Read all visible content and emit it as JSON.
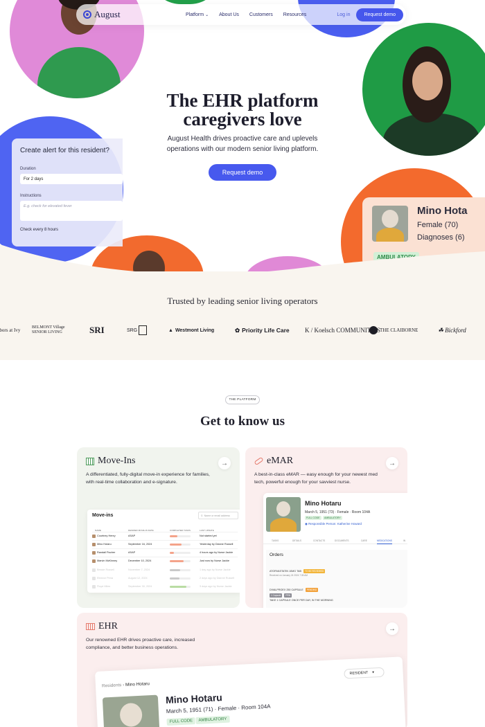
{
  "nav": {
    "brand": "August",
    "links": [
      "Platform",
      "About Us",
      "Customers",
      "Resources"
    ],
    "login": "Log in",
    "cta": "Request demo"
  },
  "hero": {
    "title_line1": "The EHR platform",
    "title_line2": "caregivers love",
    "subtitle_line1": "August Health drives proactive care and uplevels",
    "subtitle_line2": "operations with our modern senior living platform.",
    "cta": "Request demo",
    "colors": {
      "accent": "#4759ee",
      "pink": "#e08ad8",
      "green": "#1f9b45",
      "blue": "#4f64f2",
      "orange": "#f36a2d"
    }
  },
  "alert_card": {
    "title": "Create alert for this resident?",
    "duration_label": "Duration",
    "duration_value": "For 2 days",
    "instructions_label": "Instructions",
    "instructions_placeholder": "E.g. check for elevated fever",
    "footer": "Check every 8 hours"
  },
  "patient_card": {
    "name": "Mino Hota",
    "sex_age": "Female (70)",
    "diagnoses": "Diagnoses (6)",
    "badge": "AMBULATORY"
  },
  "trusted": {
    "title": "Trusted by leading senior living operators",
    "logos": [
      "Arbors at Ivy",
      "BELMONT Village SENIOR LIVING",
      "SRI",
      "SRG",
      "Westmont Living",
      "Priority Life Care",
      "K / Koelsch COMMUNITIES",
      "THE CLAIBORNE",
      "Bickford"
    ]
  },
  "platform": {
    "pill": "THE PLATFORM",
    "title": "Get to know us"
  },
  "movein": {
    "title": "Move-Ins",
    "desc_line1": "A differentiated, fully-digital move-in experience for families,",
    "desc_line2": "with real-time collaboration and e-signature.",
    "table_title": "Move-ins",
    "search_placeholder": "Name or email address",
    "headers": [
      "NAME",
      "DESIRED MOVE-IN DATE",
      "COMPLETED TASKS",
      "LAST UPDATE"
    ],
    "rows": [
      {
        "name": "Courtney Henry",
        "date": "ASAP",
        "progress": 0.35,
        "update": "Not started yet"
      },
      {
        "name": "Mino Hotaru",
        "date": "September 16, 2024",
        "progress": 0.55,
        "update": "Yesterday by Dianne Russell"
      },
      {
        "name": "Randall Fischer",
        "date": "ASAP",
        "progress": 0.2,
        "update": "4 hours ago by Nurse Jackie"
      },
      {
        "name": "Marvin McKinney",
        "date": "December 10, 2024",
        "progress": 0.65,
        "update": "Just now by Nurse Jackie"
      },
      {
        "name": "Bessie Russell",
        "date": "November 7, 2024",
        "progress": 0.5,
        "update": "1 day ago by Nurse Jackie"
      },
      {
        "name": "Eleanor Pena",
        "date": "August 12, 2024",
        "progress": 0.45,
        "update": "2 days ago by Dianne Russell"
      },
      {
        "name": "Floyd Miles",
        "date": "September 30, 2024",
        "progress": 0.8,
        "update": "3 days ago by Nurse Jackie"
      }
    ]
  },
  "emar": {
    "title": "eMAR",
    "desc_line1": "A best-in-class eMAR — easy enough for your newest med",
    "desc_line2": "tech, powerful enough for your savviest nurse.",
    "name": "Mino Hotaru",
    "dob": "March 5, 1951 (73) · Female · Room 104A",
    "tags": [
      "FULL CODE",
      "AMBULATORY"
    ],
    "responsible": "Responsible Person: Katherine Howard",
    "tabs": [
      "TASKS",
      "DETAILS",
      "CONTACTS",
      "DOCUMENTS",
      "CARE",
      "MEDICATIONS",
      "IN"
    ],
    "orders_title": "Orders",
    "order1": "ATORVASTATIN 10MG TAB",
    "order1_chip": "TO BE REVIEWED",
    "order1_meta": "Received on January 24 2024 7:35 AM",
    "order2": "DIVALPROEX 250 CAPSULE",
    "order2_chip": "PENDING",
    "order2_tags": [
      "1 Capsule",
      "PRN"
    ],
    "order2_note": "TAKE 1 CAPSULE ONCE PER DAY, IN THE MORNING"
  },
  "ehr": {
    "title": "EHR",
    "desc_line1": "Our renowned EHR drives proactive care, increased",
    "desc_line2": "compliance, and better business operations.",
    "crumb_root": "Residents",
    "crumb_current": "Mino Hotaru",
    "name": "Mino Hotaru",
    "dob": "March 5, 1951 (71) · Female · Room 104A",
    "tags": [
      "FULL CODE",
      "AMBULATORY"
    ],
    "select": "RESIDENT"
  }
}
